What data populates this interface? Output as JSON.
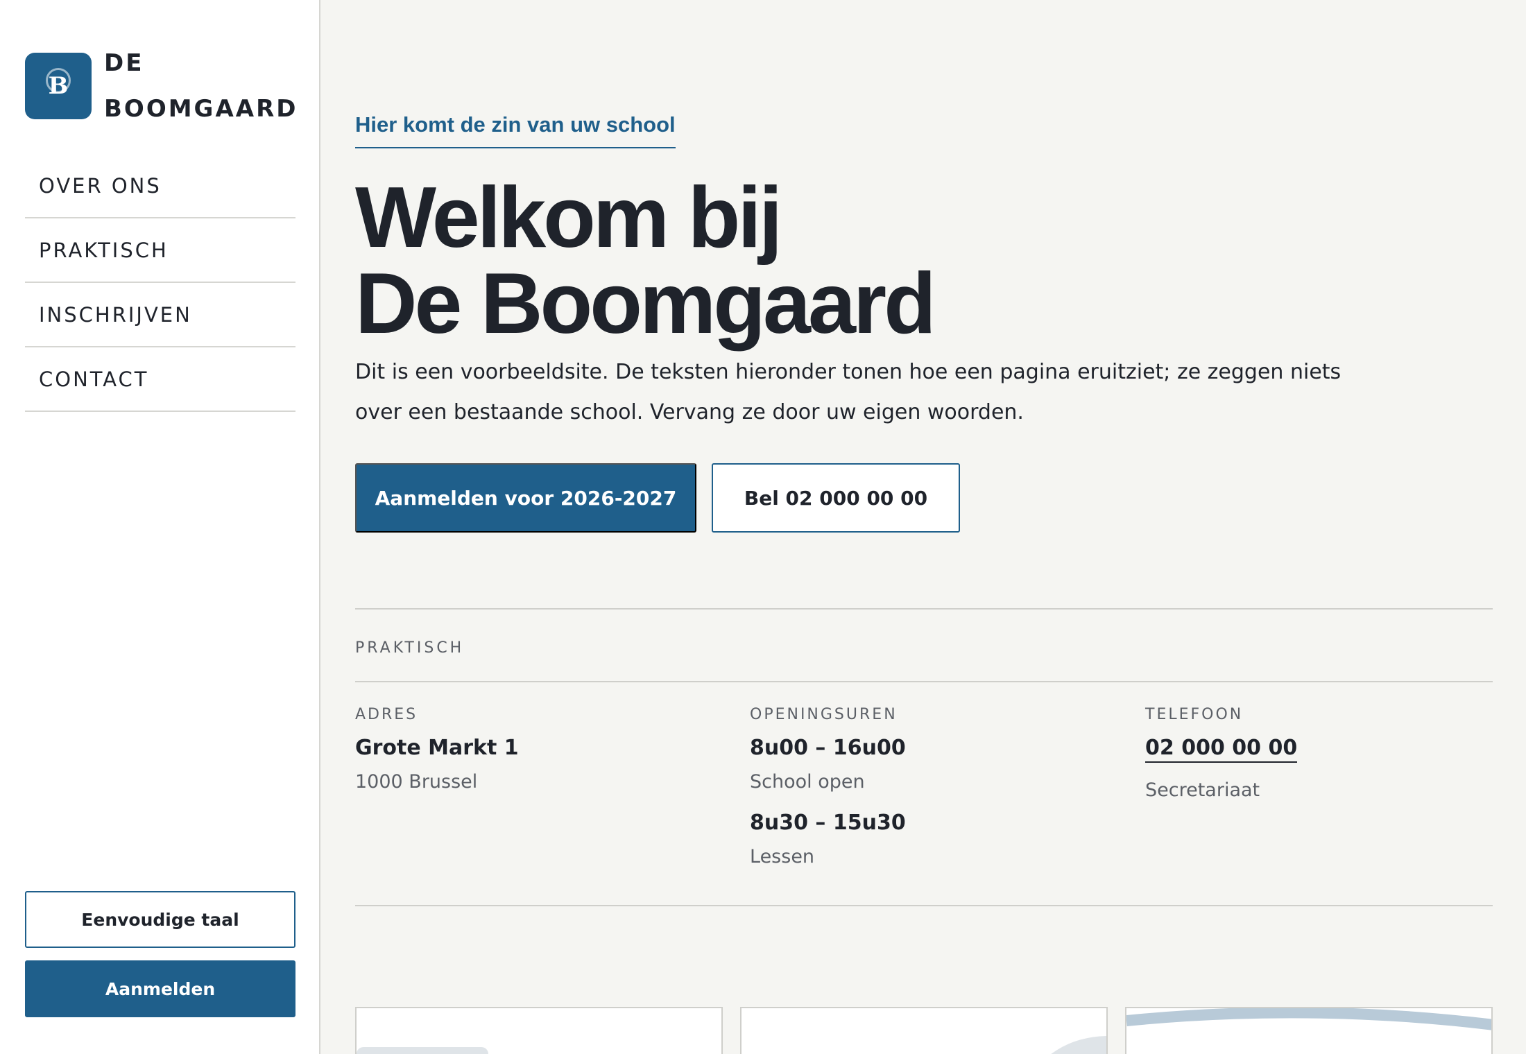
{
  "brand": {
    "logo_letter": "B",
    "name_line1": "DE",
    "name_line2": "BOOMGAARD",
    "accent_color": "#1f5f8b"
  },
  "nav": {
    "items": [
      {
        "label": "OVER ONS"
      },
      {
        "label": "PRAKTISCH"
      },
      {
        "label": "INSCHRIJVEN"
      },
      {
        "label": "CONTACT"
      }
    ]
  },
  "sidebar_actions": {
    "easy_language": "Eenvoudige taal",
    "signup": "Aanmelden"
  },
  "hero": {
    "eyebrow": "Hier komt de zin van uw school",
    "headline_line1": "Welkom bij",
    "headline_line2": "De Boomgaard",
    "intro": "Dit is een voorbeeldsite. De teksten hieronder tonen hoe een pagina eruitziet; ze zeggen niets over een bestaande school. Vervang ze door uw eigen woorden.",
    "cta_primary": "Aanmelden voor 2026-2027",
    "cta_secondary": "Bel 02 000 00 00"
  },
  "practical": {
    "section_label": "PRAKTISCH",
    "address": {
      "label": "ADRES",
      "street": "Grote Markt 1",
      "city": "1000 Brussel"
    },
    "hours": {
      "label": "OPENINGSUREN",
      "school_time": "8u00 – 16u00",
      "school_caption": "School open",
      "lessons_time": "8u30 – 15u30",
      "lessons_caption": "Lessen"
    },
    "phone": {
      "label": "TELEFOON",
      "number": "02 000 00 00",
      "caption": "Secretariaat"
    }
  }
}
